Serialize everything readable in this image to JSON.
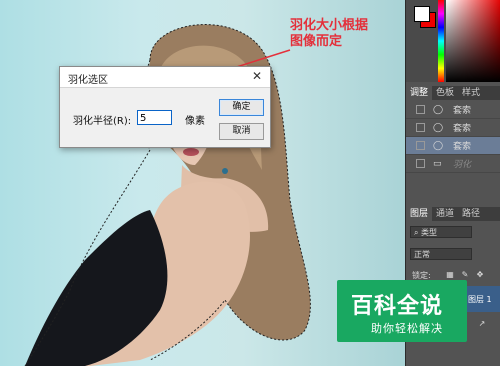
{
  "annotation": {
    "line1": "羽化大小根据",
    "line2": "图像而定",
    "color": "#e4303b"
  },
  "dialog": {
    "title": "羽化选区",
    "close_glyph": "✕",
    "radius_label": "羽化半径(R):",
    "radius_value": "5",
    "unit": "像素",
    "ok_label": "确定",
    "cancel_label": "取消"
  },
  "panel": {
    "tabs_top": [
      "调整",
      "色板",
      "样式"
    ],
    "history_items": [
      {
        "label": "套索",
        "selected": false
      },
      {
        "label": "套索",
        "selected": false
      },
      {
        "label": "套索",
        "selected": true
      }
    ],
    "history_last": "羽化",
    "tabs_layers": [
      "图层",
      "通道",
      "路径"
    ],
    "filter_label": "类型",
    "blend_mode": "正常",
    "lock_label": "锁定:",
    "layer_name": "图层 1"
  },
  "watermark": {
    "big": "百科全说",
    "sub": "助你轻松解决",
    "color": "#19a861"
  }
}
